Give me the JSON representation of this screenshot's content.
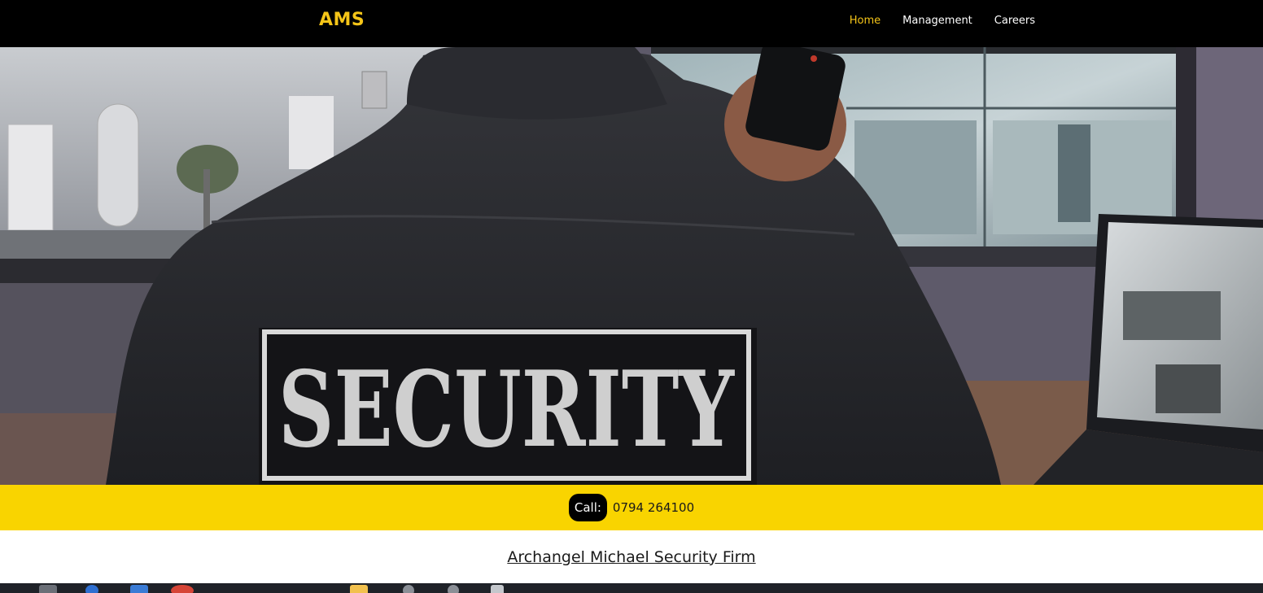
{
  "navbar": {
    "brand": "AMS",
    "links": [
      {
        "label": "Home",
        "active": true
      },
      {
        "label": "Management",
        "active": false
      },
      {
        "label": "Careers",
        "active": false
      }
    ]
  },
  "hero": {
    "patch_text": "SECURITY"
  },
  "callbar": {
    "call_label": "Call:",
    "phone_number": "0794 264100"
  },
  "footer": {
    "firm_name": "Archangel Michael Security Firm"
  },
  "colors": {
    "accent": "#f9d400",
    "brand": "#f5c518",
    "navbar_bg": "#000000"
  }
}
